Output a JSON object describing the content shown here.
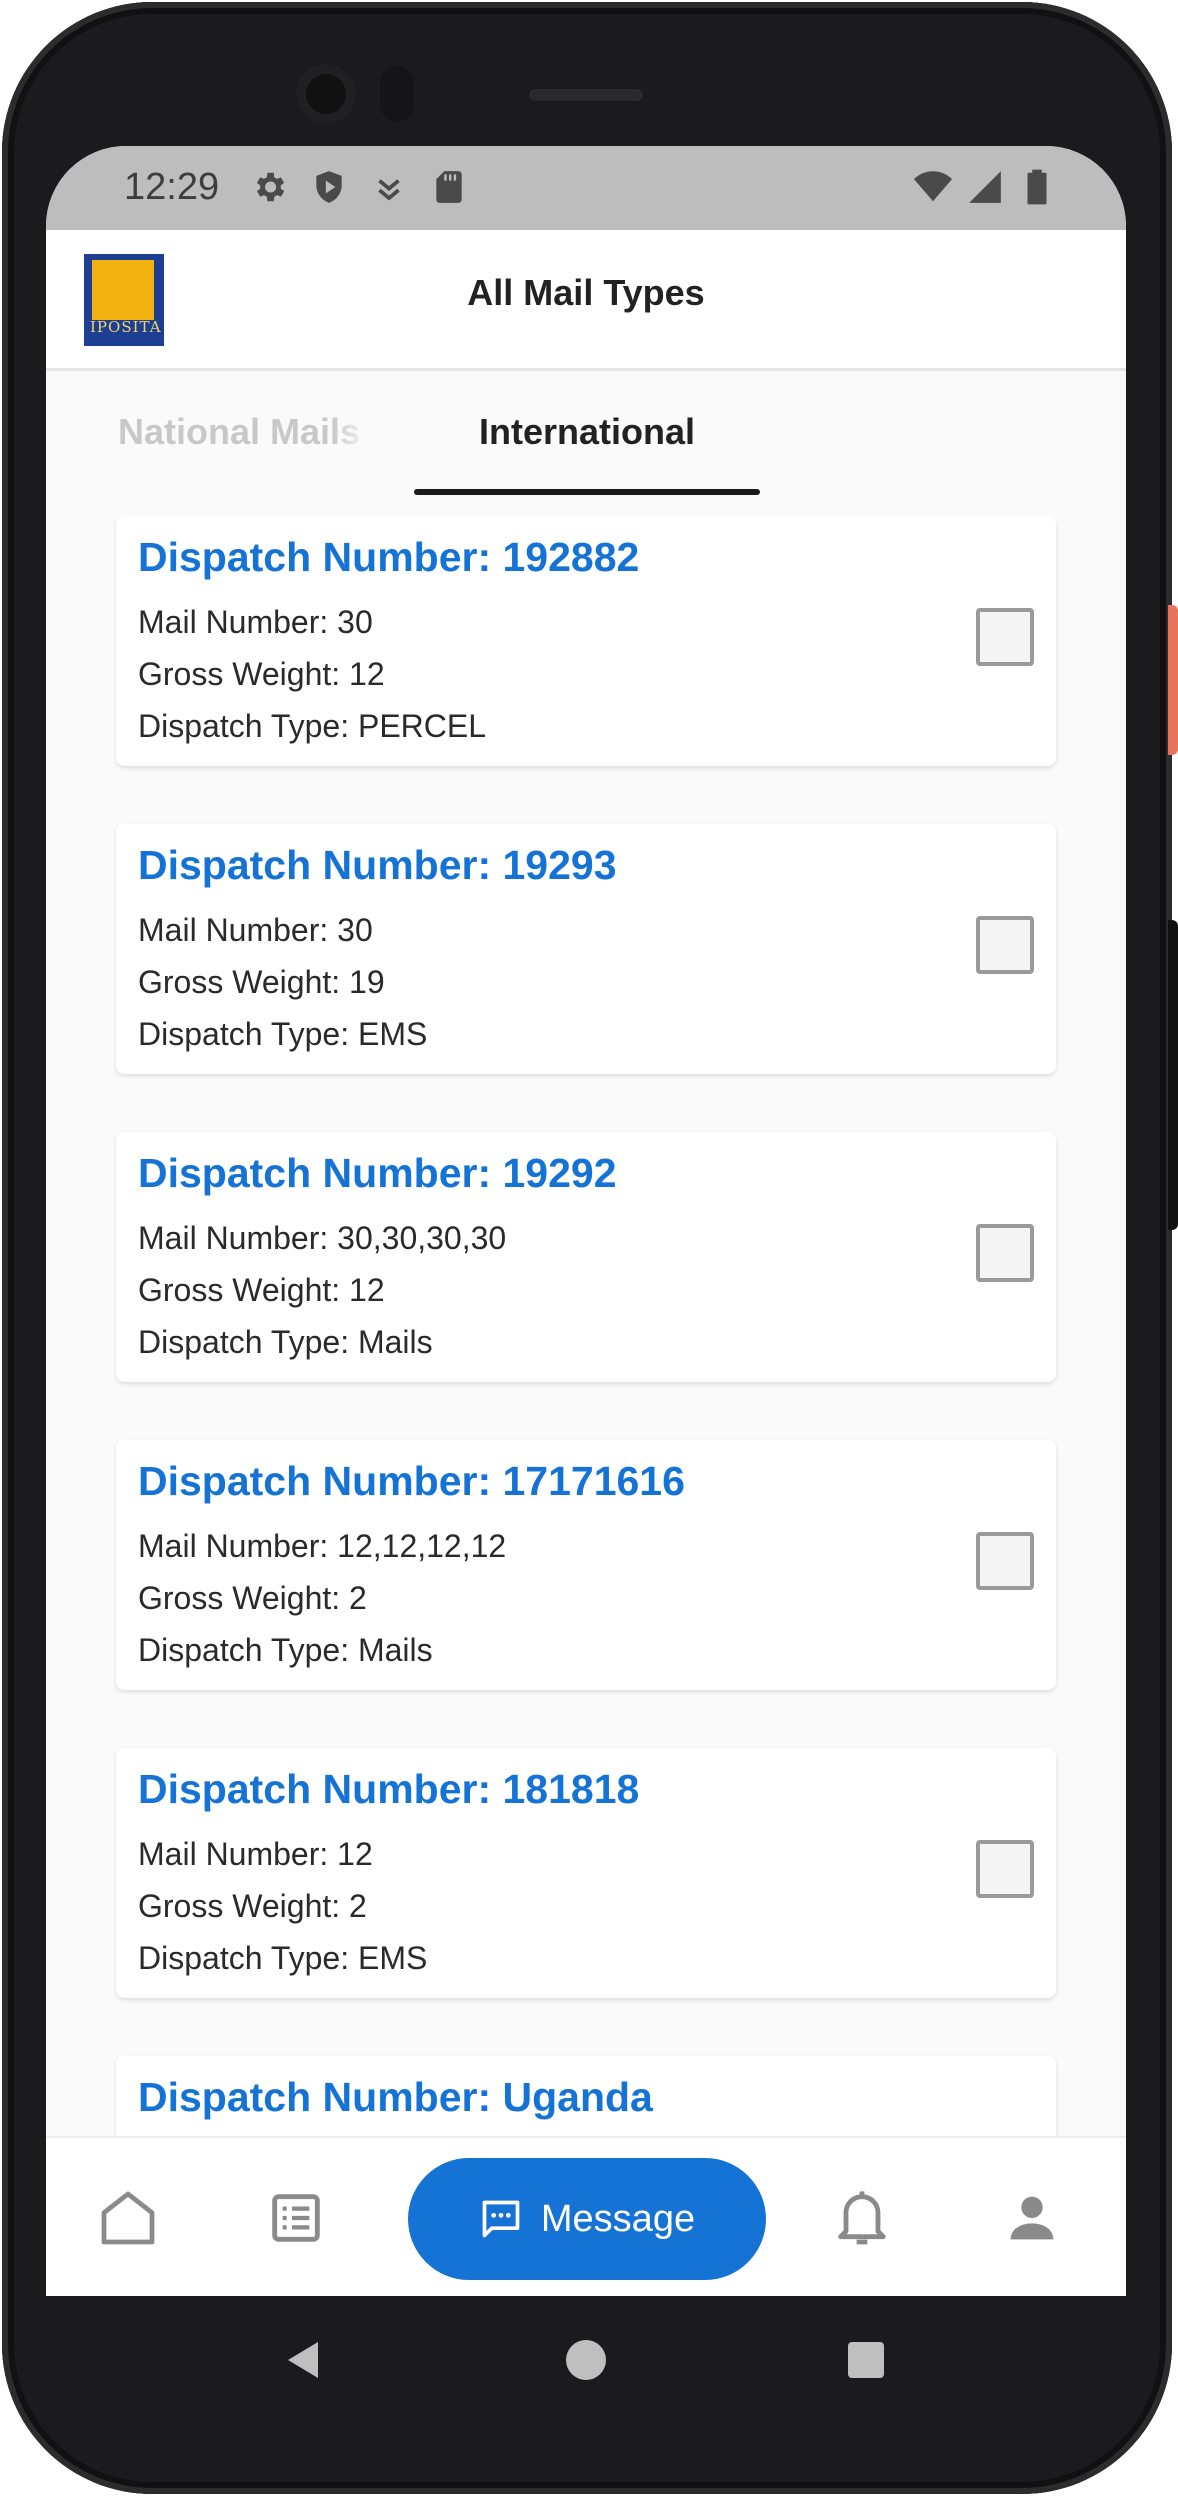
{
  "status_bar": {
    "time": "12:29"
  },
  "app_bar": {
    "title": "All Mail Types",
    "logo_text": "IPOSITA"
  },
  "tabs": [
    {
      "label": "National Mails",
      "active": false
    },
    {
      "label": "International",
      "active": true
    }
  ],
  "dispatches": [
    {
      "title": "Dispatch Number: 192882",
      "mail": "Mail Number: 30",
      "weight": "Gross Weight: 12",
      "type": "Dispatch Type: PERCEL"
    },
    {
      "title": "Dispatch Number: 19293",
      "mail": "Mail Number: 30",
      "weight": "Gross Weight: 19",
      "type": "Dispatch Type: EMS"
    },
    {
      "title": "Dispatch Number: 19292",
      "mail": "Mail Number: 30,30,30,30",
      "weight": "Gross Weight: 12",
      "type": "Dispatch Type: Mails"
    },
    {
      "title": "Dispatch Number: 17171616",
      "mail": "Mail Number: 12,12,12,12",
      "weight": "Gross Weight: 2",
      "type": "Dispatch Type: Mails"
    },
    {
      "title": "Dispatch Number: 181818",
      "mail": "Mail Number: 12",
      "weight": "Gross Weight: 2",
      "type": "Dispatch Type: EMS"
    },
    {
      "title": "Dispatch Number: Uganda"
    }
  ],
  "bottom_nav": {
    "message_label": "Message",
    "icons": [
      "home-icon",
      "list-icon",
      "message-icon",
      "bell-icon",
      "profile-icon"
    ]
  },
  "colors": {
    "accent": "#1673d6",
    "tab_inactive": "#c8c8c8",
    "status_bar": "#bdbdbd"
  }
}
